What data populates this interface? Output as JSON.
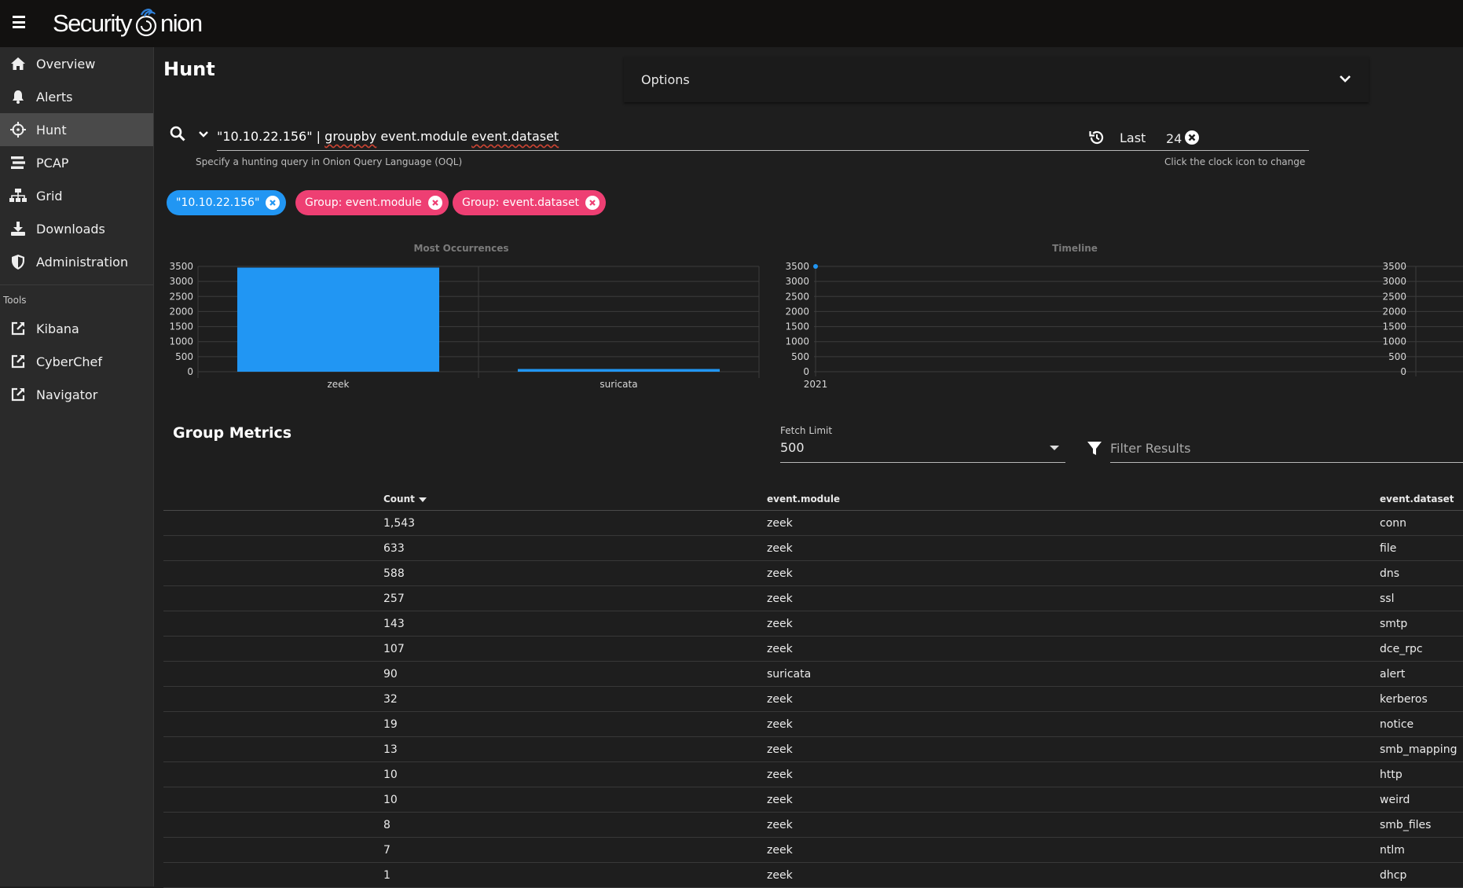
{
  "app": {
    "logo_text_left": "Security",
    "logo_text_right": "nion"
  },
  "sidebar": {
    "items": [
      {
        "label": "Overview",
        "icon": "home-icon"
      },
      {
        "label": "Alerts",
        "icon": "bell-icon"
      },
      {
        "label": "Hunt",
        "icon": "crosshairs-icon",
        "active": true
      },
      {
        "label": "PCAP",
        "icon": "stream-icon"
      },
      {
        "label": "Grid",
        "icon": "sitemap-icon"
      },
      {
        "label": "Downloads",
        "icon": "download-icon"
      },
      {
        "label": "Administration",
        "icon": "shield-icon"
      }
    ],
    "tools_label": "Tools",
    "tools": [
      {
        "label": "Kibana",
        "icon": "external-link-icon"
      },
      {
        "label": "CyberChef",
        "icon": "external-link-icon"
      },
      {
        "label": "Navigator",
        "icon": "external-link-icon"
      }
    ]
  },
  "page": {
    "title": "Hunt",
    "options_label": "Options"
  },
  "query": {
    "value_prefix": "\"10.10.22.156\" | ",
    "value_underlined1": "groupby",
    "value_mid": " event.module ",
    "value_underlined2": "event.dataset",
    "hint": "Specify a hunting query in Onion Query Language (OQL)"
  },
  "date_range": {
    "label": "Last",
    "value": "24",
    "hint": "Click the clock icon to change"
  },
  "chips": [
    {
      "label": "\"10.10.22.156\"",
      "color": "#2196f3"
    },
    {
      "label": "Group: event.module",
      "color": "#ee3f73"
    },
    {
      "label": "Group: event.dataset",
      "color": "#ee3f73"
    }
  ],
  "chart_data": [
    {
      "type": "bar",
      "title": "Most Occurrences",
      "categories": [
        "zeek",
        "suricata"
      ],
      "values": [
        3461,
        90
      ],
      "ylim": [
        0,
        3500
      ],
      "yticks": [
        "3500",
        "3000",
        "2500",
        "2000",
        "1500",
        "1000",
        "500",
        "0"
      ],
      "color": "#2196f3",
      "grid": true
    },
    {
      "type": "line",
      "title": "Timeline",
      "x": [
        "2021"
      ],
      "values": [
        3551
      ],
      "ylim": [
        0,
        3500
      ],
      "yticks": [
        "3500",
        "3000",
        "2500",
        "2000",
        "1500",
        "1000",
        "500",
        "0"
      ],
      "color": "#2196f3",
      "grid": true
    }
  ],
  "group_metrics": {
    "title": "Group Metrics",
    "fetch_limit_label": "Fetch Limit",
    "fetch_limit_value": "500",
    "filter_placeholder": "Filter Results",
    "columns": [
      "Count",
      "event.module",
      "event.dataset"
    ],
    "rows": [
      [
        "1,543",
        "zeek",
        "conn"
      ],
      [
        "633",
        "zeek",
        "file"
      ],
      [
        "588",
        "zeek",
        "dns"
      ],
      [
        "257",
        "zeek",
        "ssl"
      ],
      [
        "143",
        "zeek",
        "smtp"
      ],
      [
        "107",
        "zeek",
        "dce_rpc"
      ],
      [
        "90",
        "suricata",
        "alert"
      ],
      [
        "32",
        "zeek",
        "kerberos"
      ],
      [
        "19",
        "zeek",
        "notice"
      ],
      [
        "13",
        "zeek",
        "smb_mapping"
      ],
      [
        "10",
        "zeek",
        "http"
      ],
      [
        "10",
        "zeek",
        "weird"
      ],
      [
        "8",
        "zeek",
        "smb_files"
      ],
      [
        "7",
        "zeek",
        "ntlm"
      ],
      [
        "1",
        "zeek",
        "dhcp"
      ]
    ]
  }
}
